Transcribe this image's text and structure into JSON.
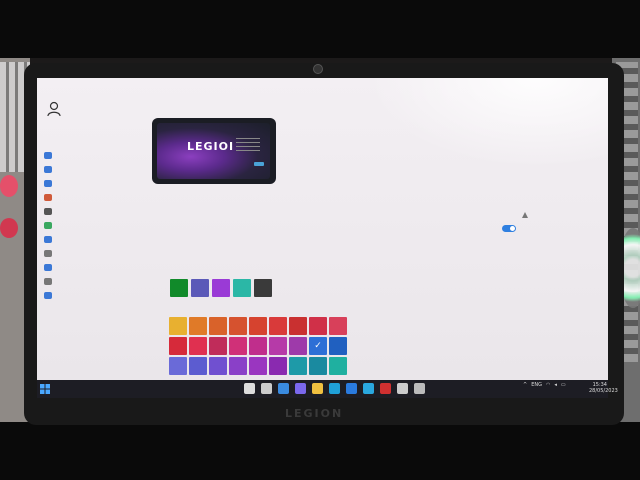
{
  "scene": {
    "laptop_brand": "LEGION"
  },
  "wallpaper_preview": {
    "text": "LEGIOI"
  },
  "sidebar": {
    "items": [
      {
        "icon": "home-icon",
        "color": "#3b78d6"
      },
      {
        "icon": "system-icon",
        "color": "#3b78d6"
      },
      {
        "icon": "bluetooth-icon",
        "color": "#3b78d6"
      },
      {
        "icon": "personalization-brush-icon",
        "color": "#d05a3a"
      },
      {
        "icon": "apps-icon",
        "color": "#555555"
      },
      {
        "icon": "accounts-icon",
        "color": "#3aa860"
      },
      {
        "icon": "time-language-icon",
        "color": "#3b78d6"
      },
      {
        "icon": "gaming-icon",
        "color": "#777777"
      },
      {
        "icon": "accessibility-icon",
        "color": "#3b78d6"
      },
      {
        "icon": "privacy-shield-icon",
        "color": "#777777"
      },
      {
        "icon": "windows-update-icon",
        "color": "#3b78d6"
      }
    ]
  },
  "recent_colors": [
    "#118a2a",
    "#5b59b8",
    "#9a3ad6",
    "#2bb7a6",
    "#3a3a3a"
  ],
  "windows_colors": [
    "#e8b030",
    "#e07a28",
    "#d9622a",
    "#d6522f",
    "#d6432f",
    "#d93a3a",
    "#c93030",
    "#d03048",
    "#d8405a",
    "#d62a3a",
    "#e03050",
    "#c02c5a",
    "#d03078",
    "#c02e8c",
    "#b63aa8",
    "#9e3aaa",
    "#2d6fd6",
    "#2060c0",
    "#6a6ad8",
    "#5c5cd0",
    "#7050d0",
    "#8a40c8",
    "#9a36c0",
    "#8a2ab0",
    "#1e9aa8",
    "#1a8aa0",
    "#1fb0a0"
  ],
  "selected_color_index": 16,
  "taskbar": {
    "apps": [
      {
        "icon": "start-windows-icon",
        "color": "#4aa8ff"
      },
      {
        "icon": "search-icon",
        "color": "#dddddd"
      },
      {
        "icon": "task-view-icon",
        "color": "#cccccc"
      },
      {
        "icon": "widgets-icon",
        "color": "#3a8be0"
      },
      {
        "icon": "teams-chat-icon",
        "color": "#7b68ee"
      },
      {
        "icon": "file-explorer-icon",
        "color": "#f0c040"
      },
      {
        "icon": "edge-icon",
        "color": "#1fa0d8"
      },
      {
        "icon": "store-icon",
        "color": "#2a7be0"
      },
      {
        "icon": "legion-icon",
        "color": "#2aa8e0"
      },
      {
        "icon": "mcafee-icon",
        "color": "#d03030"
      },
      {
        "icon": "xbox-icon",
        "color": "#cccccc"
      },
      {
        "icon": "settings-gear-icon",
        "color": "#bbbbbb"
      }
    ],
    "tray_language": "ENG",
    "clock_time": "15:34",
    "clock_date": "28/05/2023"
  }
}
